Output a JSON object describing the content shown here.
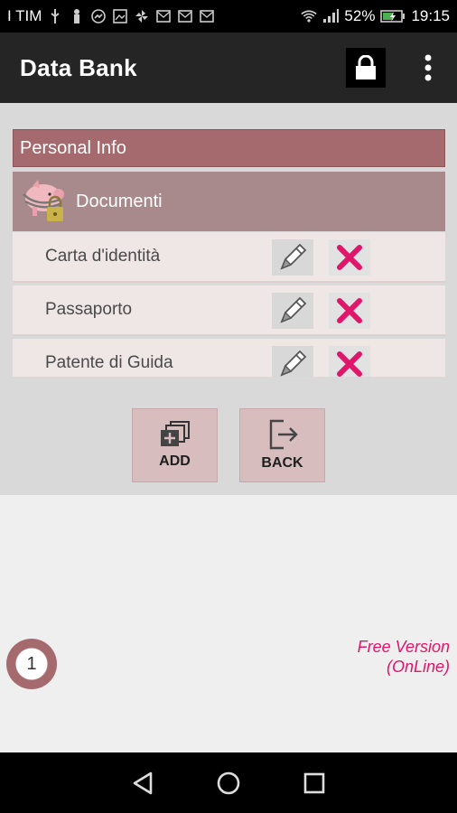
{
  "status_bar": {
    "carrier": "I TIM",
    "battery": "52%",
    "time": "19:15"
  },
  "app_bar": {
    "title": "Data Bank",
    "icons": [
      "lock-icon",
      "more-vert-icon"
    ]
  },
  "section": {
    "title": "Personal Info"
  },
  "category": {
    "label": "Documenti",
    "icon": "piggy-bank-lock-icon"
  },
  "items": [
    {
      "label": "Carta d'identità"
    },
    {
      "label": "Passaporto"
    },
    {
      "label": "Patente di Guida"
    }
  ],
  "actions": {
    "add_label": "ADD",
    "back_label": "BACK"
  },
  "footer": {
    "count": "1",
    "version_line1": "Free Version",
    "version_line2": "(OnLine)"
  },
  "colors": {
    "header": "#a56a6d",
    "category": "#a98a8c",
    "delete": "#e0166b",
    "accent_text": "#e0166b"
  }
}
